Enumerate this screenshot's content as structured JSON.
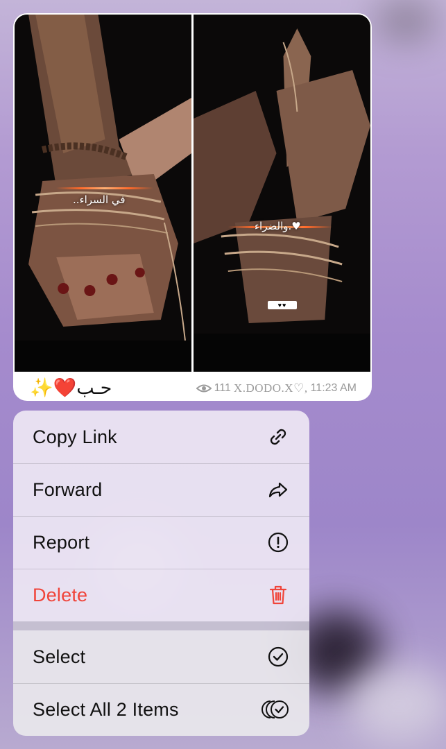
{
  "message": {
    "photo_captions": [
      "..في السراء",
      "والضراء.♥"
    ],
    "hearts_tag": "♥♥",
    "caption": {
      "text": "حـب",
      "heart": "❤️",
      "sparkle": "✨"
    },
    "views": "111",
    "author": "X.DODO.X♡,",
    "time": "11:23 AM",
    "view_icon": "eye-icon"
  },
  "menu": {
    "items": [
      {
        "label": "Copy Link",
        "icon": "link-icon"
      },
      {
        "label": "Forward",
        "icon": "forward-arrow-icon"
      },
      {
        "label": "Report",
        "icon": "exclamation-circle-icon"
      },
      {
        "label": "Delete",
        "icon": "trash-icon",
        "destructive": true
      }
    ],
    "secondary_items": [
      {
        "label": "Select",
        "icon": "check-circle-icon"
      },
      {
        "label": "Select All 2 Items",
        "icon": "multi-check-circle-icon"
      }
    ],
    "destructive_color": "#f0443a"
  }
}
